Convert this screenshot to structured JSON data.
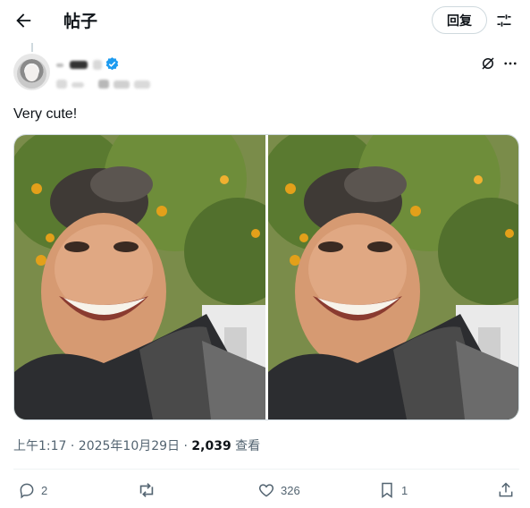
{
  "header": {
    "title": "帖子",
    "reply_label": "回复"
  },
  "post": {
    "text": "Very cute!",
    "timestamp": "上午1:17 · 2025年10月29日 · ",
    "views_count": "2,039",
    "views_label": " 查看"
  },
  "actions": {
    "replies": "2",
    "likes": "326",
    "bookmarks": "1"
  },
  "colors": {
    "verified": "#1d9bf0",
    "text": "#0f1419",
    "muted": "#536471",
    "border": "#cfd9de"
  }
}
